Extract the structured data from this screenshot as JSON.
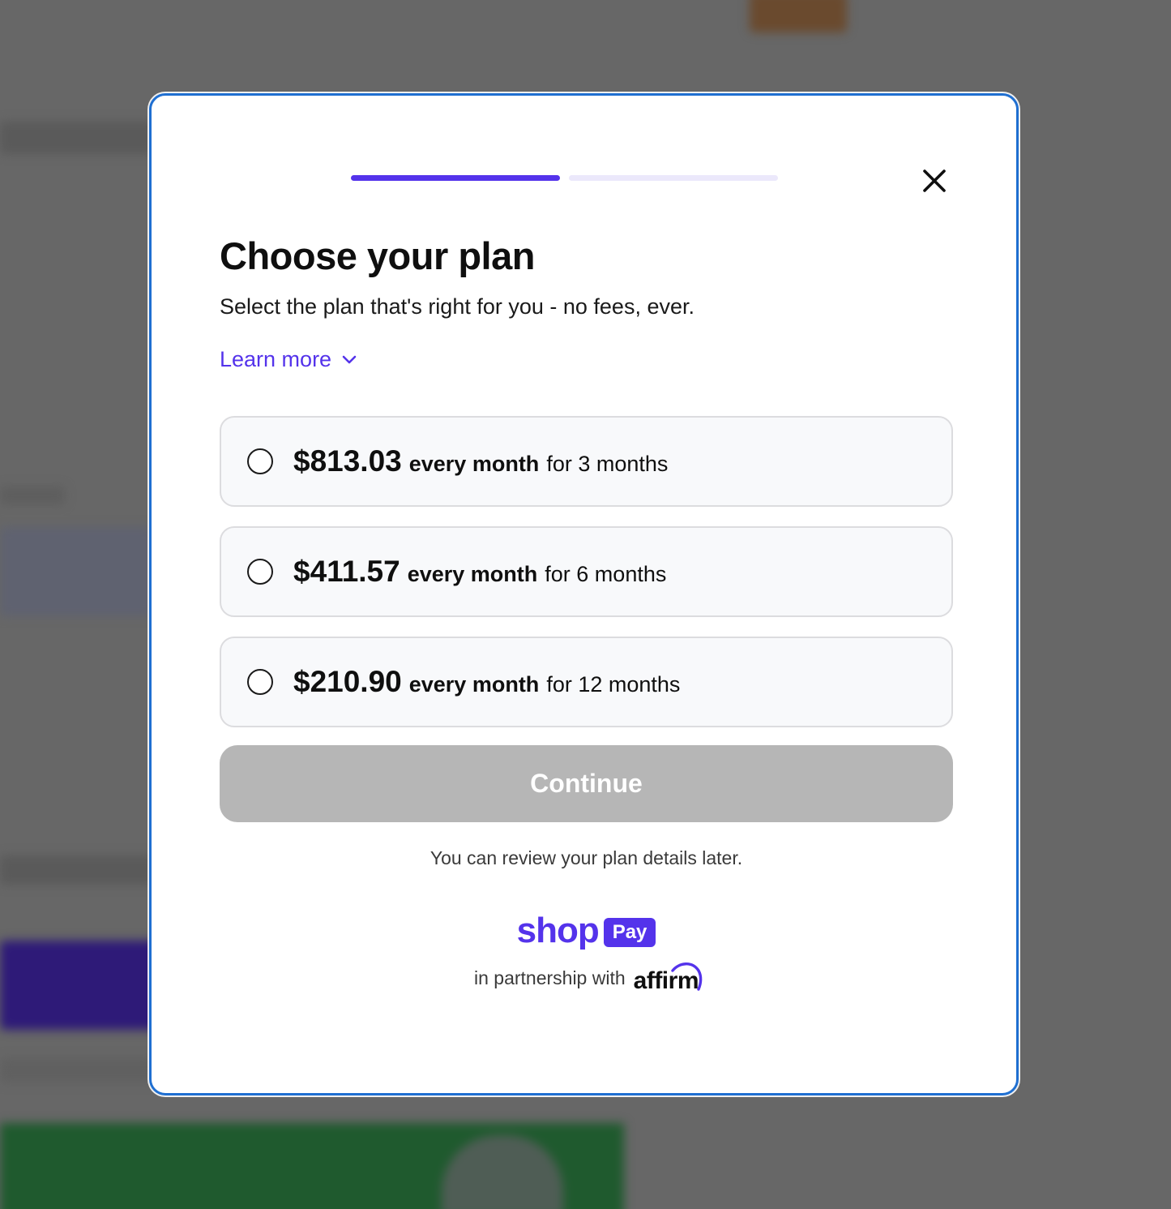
{
  "progress": {
    "steps_total": 2,
    "current_step": 1
  },
  "modal": {
    "close_icon": "close-icon",
    "title": "Choose your plan",
    "subtitle": "Select the plan that's right for you - no fees, ever.",
    "learn_more": {
      "label": "Learn more",
      "icon": "chevron-down-icon"
    }
  },
  "plans": [
    {
      "price": "$813.03",
      "frequency": "every month",
      "term": "for 3 months",
      "selected": false
    },
    {
      "price": "$411.57",
      "frequency": "every month",
      "term": "for 6 months",
      "selected": false
    },
    {
      "price": "$210.90",
      "frequency": "every month",
      "term": "for 12 months",
      "selected": false
    }
  ],
  "continue_button": {
    "label": "Continue",
    "disabled": true
  },
  "review_note": "You can review your plan details later.",
  "branding": {
    "shop_word": "shop",
    "pay_badge": "Pay",
    "partnership_text": "in partnership with",
    "partner_logo": "affirm"
  },
  "colors": {
    "accent": "#5433eb",
    "modal_border": "#1f6fd1",
    "disabled_button": "#b6b6b6",
    "overlay": "#676767"
  }
}
